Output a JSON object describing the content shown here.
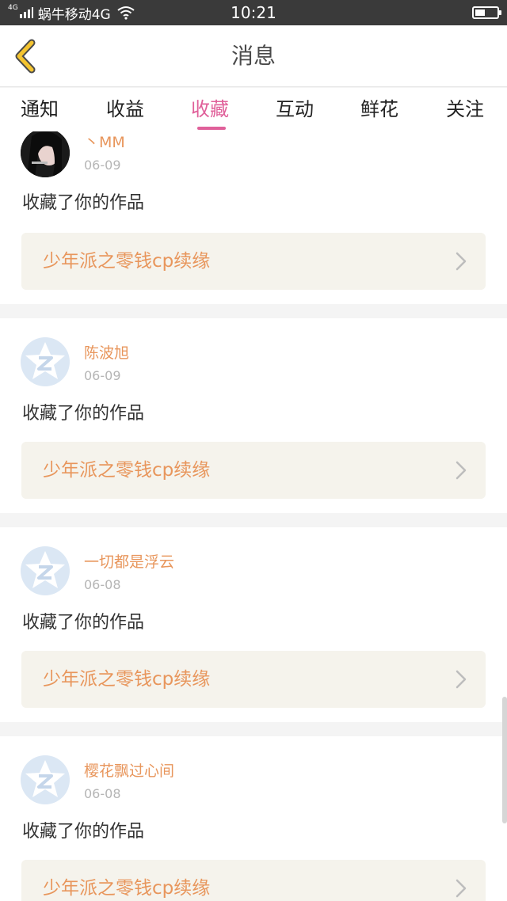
{
  "status_bar": {
    "network_type": "4G",
    "carrier": "蜗牛移动4G",
    "time": "10:21",
    "icons": [
      "signal-icon",
      "wifi-icon",
      "battery-icon"
    ]
  },
  "header": {
    "title": "消息",
    "back_icon": "back-chevron-icon",
    "accent_color": "#f4c430"
  },
  "tabs": [
    {
      "label": "通知",
      "active": false
    },
    {
      "label": "收益",
      "active": false
    },
    {
      "label": "收藏",
      "active": true
    },
    {
      "label": "互动",
      "active": false
    },
    {
      "label": "鲜花",
      "active": false
    },
    {
      "label": "关注",
      "active": false
    }
  ],
  "colors": {
    "active_tab": "#e0609a",
    "username": "#e8965c",
    "work_title": "#e8965c",
    "date": "#b5b5b5",
    "link_bg": "#f5f3ec"
  },
  "messages": [
    {
      "username": "丶MM",
      "date": "06-09",
      "action": "收藏了你的作品",
      "work_title": "少年派之零钱cp续缘",
      "avatar": "photo"
    },
    {
      "username": "陈波旭",
      "date": "06-09",
      "action": "收藏了你的作品",
      "work_title": "少年派之零钱cp续缘",
      "avatar": "default-z-icon"
    },
    {
      "username": "一切都是浮云",
      "date": "06-08",
      "action": "收藏了你的作品",
      "work_title": "少年派之零钱cp续缘",
      "avatar": "default-z-icon"
    },
    {
      "username": "樱花飘过心间",
      "date": "06-08",
      "action": "收藏了你的作品",
      "work_title": "少年派之零钱cp续缘",
      "avatar": "default-z-icon"
    }
  ]
}
